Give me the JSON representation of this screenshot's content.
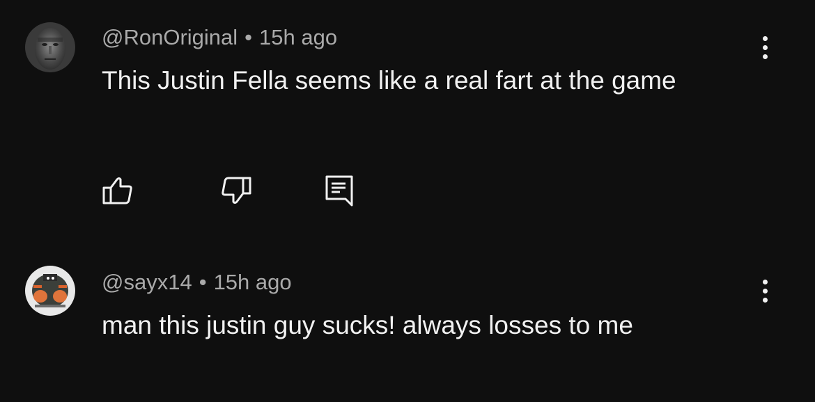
{
  "comments": [
    {
      "author": "@RonOriginal",
      "separator": "•",
      "time": "15h ago",
      "text": "This Justin Fella seems like a real fart at the game",
      "avatar": "grey-face-avatar",
      "actions": [
        "thumbs-up-icon",
        "thumbs-down-icon",
        "reply-icon"
      ]
    },
    {
      "author": "@sayx14",
      "separator": "•",
      "time": "15h ago",
      "text": "man this justin guy sucks! always losses to me",
      "avatar": "orange-creature-avatar"
    }
  ],
  "colors": {
    "background": "#0f0f0f",
    "text": "#f1f1f1",
    "meta": "#aaaaaa"
  }
}
